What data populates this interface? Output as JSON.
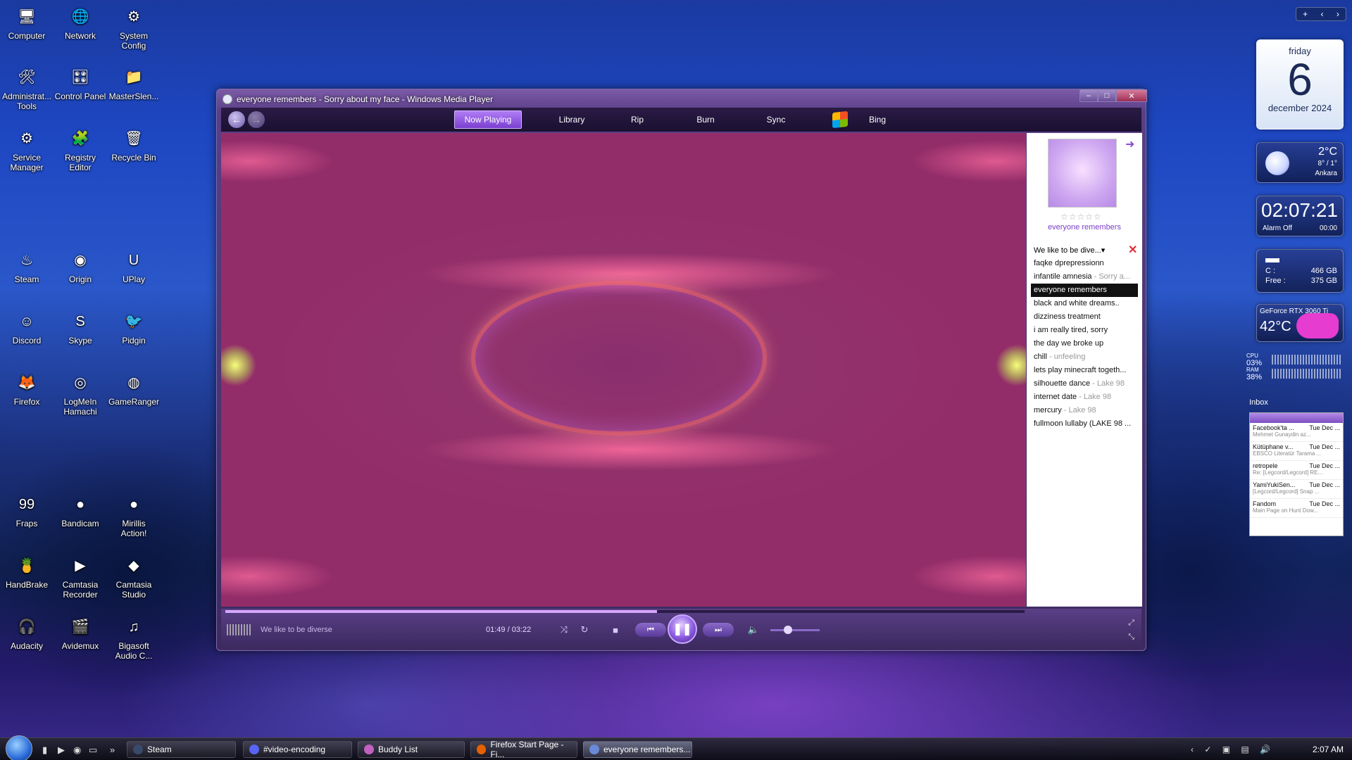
{
  "desktop": {
    "icons": [
      {
        "label": "Computer",
        "icon": "computer-icon"
      },
      {
        "label": "Network",
        "icon": "network-icon"
      },
      {
        "label": "System\nConfig",
        "icon": "system-config-icon"
      },
      {
        "label": "Administrat...\nTools",
        "icon": "admin-tools-icon"
      },
      {
        "label": "Control Panel",
        "icon": "control-panel-icon"
      },
      {
        "label": "MasterSlen...",
        "icon": "masterslen-icon"
      },
      {
        "label": "Service\nManager",
        "icon": "service-manager-icon"
      },
      {
        "label": "Registry\nEditor",
        "icon": "registry-editor-icon"
      },
      {
        "label": "Recycle Bin",
        "icon": "recycle-bin-icon"
      },
      {
        "label": "Steam",
        "icon": "steam-icon"
      },
      {
        "label": "Origin",
        "icon": "origin-icon"
      },
      {
        "label": "UPlay",
        "icon": "uplay-icon"
      },
      {
        "label": "Discord",
        "icon": "discord-icon"
      },
      {
        "label": "Skype",
        "icon": "skype-icon"
      },
      {
        "label": "Pidgin",
        "icon": "pidgin-icon"
      },
      {
        "label": "Firefox",
        "icon": "firefox-icon"
      },
      {
        "label": "LogMeIn\nHamachi",
        "icon": "hamachi-icon"
      },
      {
        "label": "GameRanger",
        "icon": "gameranger-icon"
      },
      {
        "label": "Fraps",
        "icon": "fraps-icon"
      },
      {
        "label": "Bandicam",
        "icon": "bandicam-icon"
      },
      {
        "label": "Mirillis\nAction!",
        "icon": "mirillis-icon"
      },
      {
        "label": "HandBrake",
        "icon": "handbrake-icon"
      },
      {
        "label": "Camtasia\nRecorder",
        "icon": "camtasia-recorder-icon"
      },
      {
        "label": "Camtasia\nStudio",
        "icon": "camtasia-studio-icon"
      },
      {
        "label": "Audacity",
        "icon": "audacity-icon"
      },
      {
        "label": "Avidemux",
        "icon": "avidemux-icon"
      },
      {
        "label": "Bigasoft\nAudio C...",
        "icon": "bigasoft-icon"
      }
    ]
  },
  "wmp": {
    "title": "everyone remembers - Sorry about my face - Windows Media Player",
    "tabs": [
      "Now Playing",
      "Library",
      "Rip",
      "Burn",
      "Sync",
      "Bing"
    ],
    "album_title": "everyone remembers",
    "rating_stars": "☆☆☆☆☆",
    "playlist_header": "We like to be dive...▾",
    "playlist": [
      {
        "title": "faqke dprepressionn",
        "artist": ""
      },
      {
        "title": "infantile amnesia",
        "artist": " - Sorry a..."
      },
      {
        "title": "everyone remembers",
        "artist": "",
        "current": true
      },
      {
        "title": "black and white dreams..",
        "artist": ""
      },
      {
        "title": "dizziness treatment",
        "artist": ""
      },
      {
        "title": "i am really tired, sorry",
        "artist": ""
      },
      {
        "title": "the day we broke up",
        "artist": ""
      },
      {
        "title": "chill",
        "artist": " - unfeeling"
      },
      {
        "title": "lets play minecraft togeth...",
        "artist": ""
      },
      {
        "title": "silhouette dance",
        "artist": " - Lake 98"
      },
      {
        "title": "internet date",
        "artist": " - Lake 98"
      },
      {
        "title": "mercury",
        "artist": " - Lake 98"
      },
      {
        "title": "fullmoon lullaby (LAKE 98 ...",
        "artist": ""
      }
    ],
    "track_text": "We like to be diverse",
    "time": "01:49 / 03:22",
    "progress": 0.54,
    "volume": 0.35
  },
  "gadgets": {
    "calendar": {
      "day": "friday",
      "date": "6",
      "month": "december 2024"
    },
    "weather": {
      "temp": "2°C",
      "range": "8° / 1°",
      "city": "Ankara"
    },
    "clock": {
      "time": "02:07:21",
      "alarm": "Alarm Off",
      "alarm_time": "00:00"
    },
    "drive": {
      "c_label": "C :",
      "c_value": "466 GB",
      "free_label": "Free :",
      "free_value": "375 GB"
    },
    "gpu": {
      "name": "GeForce RTX 3060 Ti",
      "temp": "42°C"
    },
    "cpu": {
      "label": "CPU",
      "pct": "03%"
    },
    "ram": {
      "label": "RAM",
      "pct": "38%"
    },
    "inbox": {
      "title": "Inbox",
      "mails": [
        {
          "from": "Facebook'ta ...",
          "date": "Tue Dec ...",
          "subject": "Mehmet Gunaydin az..."
        },
        {
          "from": "Kütüphane v...",
          "date": "Tue Dec ...",
          "subject": "EBSCO Literatür Tarama ..."
        },
        {
          "from": "retropele",
          "date": "Tue Dec ...",
          "subject": "Re: [Legcord/Legcord] RE..."
        },
        {
          "from": "YamiYukiSen...",
          "date": "Tue Dec ...",
          "subject": "[Legcord/Legcord] Snap ..."
        },
        {
          "from": "Fandom",
          "date": "Tue Dec ...",
          "subject": "Main Page on Hunt Dow..."
        }
      ]
    }
  },
  "taskbar": {
    "buttons": [
      {
        "label": "Steam",
        "color": "#3a4a6a"
      },
      {
        "label": "#video-encoding",
        "color": "#5865f2"
      },
      {
        "label": "Buddy List",
        "color": "#c060c0"
      },
      {
        "label": "Firefox Start Page - Fi...",
        "color": "#e66000"
      },
      {
        "label": "everyone remembers...",
        "color": "#6a8ad8",
        "active": true
      }
    ],
    "clock": "2:07 AM"
  },
  "colors": {
    "accent": "#8a4dd6",
    "video_bg": "#932d6a",
    "current_row": "#111111"
  }
}
